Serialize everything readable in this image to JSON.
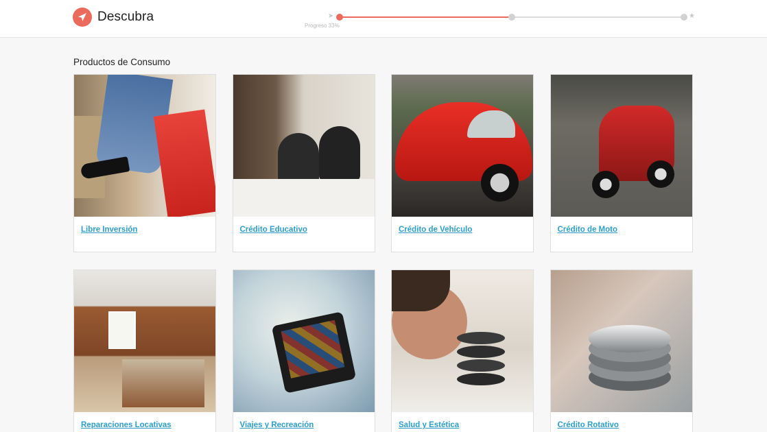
{
  "app": {
    "brand_name": "Descubra",
    "brand_color": "#ec6a5c",
    "logo_icon": "paper-plane-icon"
  },
  "progress": {
    "label": "Progreso 33%",
    "value": 0.33,
    "steps": 3,
    "current_step": 1,
    "start_icon": "pin-icon",
    "end_icon": "star-icon",
    "active_color": "#ec6a5c",
    "inactive_color": "#d2d2d2"
  },
  "section": {
    "title": "Productos de Consumo"
  },
  "products": [
    {
      "title": "Libre Inversión",
      "image": "shopping-bags-image"
    },
    {
      "title": "Crédito Educativo",
      "image": "students-studying-image"
    },
    {
      "title": "Crédito de Vehículo",
      "image": "red-beetle-car-image"
    },
    {
      "title": "Crédito de Moto",
      "image": "red-scooter-image"
    },
    {
      "title": "Reparaciones Locativas",
      "image": "kitchen-image"
    },
    {
      "title": "Viajes y Recreación",
      "image": "suitcase-map-image"
    },
    {
      "title": "Salud y Estética",
      "image": "spa-stones-image"
    },
    {
      "title": "Crédito Rotativo",
      "image": "coins-hand-image"
    }
  ],
  "theme": {
    "link_color": "#2d9fc9"
  }
}
